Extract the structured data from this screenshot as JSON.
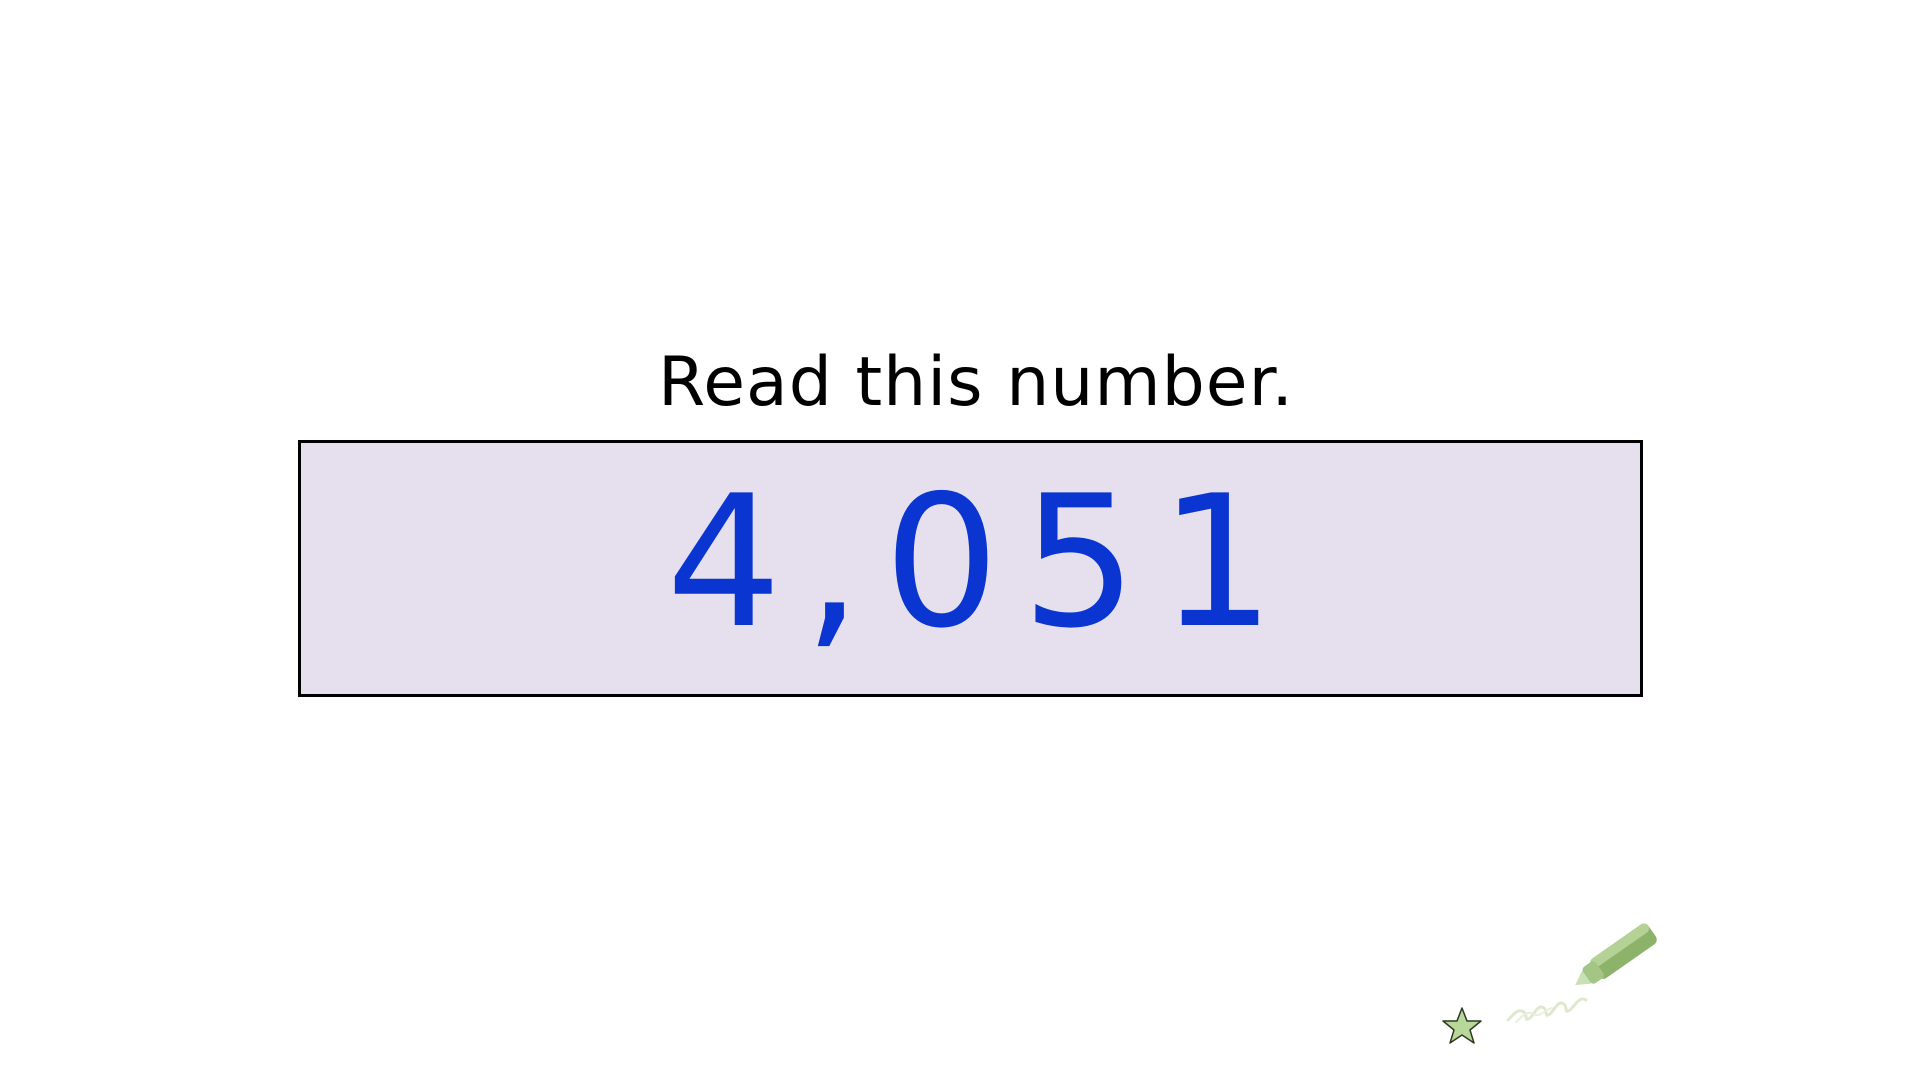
{
  "slide": {
    "prompt": "Read this number.",
    "number": "4,051"
  },
  "decoration": {
    "icons": [
      "star-icon",
      "pen-icon"
    ],
    "star_fill": "#b8d89a",
    "pen_color": "#8db36b",
    "box_fill": "#e6e0ee",
    "number_color": "#0a35d0"
  }
}
